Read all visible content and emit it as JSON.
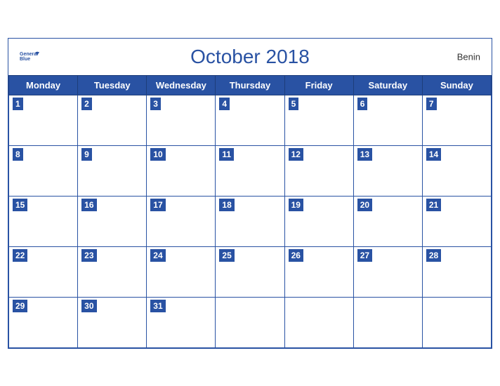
{
  "header": {
    "title": "October 2018",
    "country": "Benin",
    "logo_general": "General",
    "logo_blue": "Blue"
  },
  "weekdays": [
    "Monday",
    "Tuesday",
    "Wednesday",
    "Thursday",
    "Friday",
    "Saturday",
    "Sunday"
  ],
  "weeks": [
    [
      1,
      2,
      3,
      4,
      5,
      6,
      7
    ],
    [
      8,
      9,
      10,
      11,
      12,
      13,
      14
    ],
    [
      15,
      16,
      17,
      18,
      19,
      20,
      21
    ],
    [
      22,
      23,
      24,
      25,
      26,
      27,
      28
    ],
    [
      29,
      30,
      31,
      null,
      null,
      null,
      null
    ]
  ]
}
